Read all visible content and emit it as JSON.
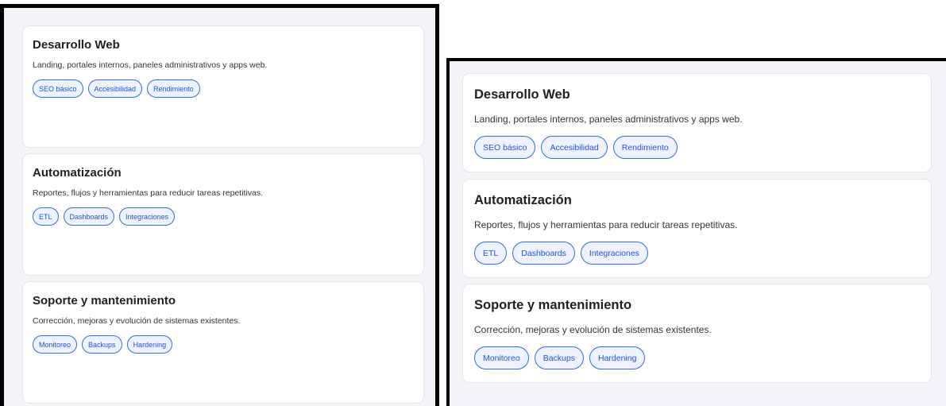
{
  "services": [
    {
      "title": "Desarrollo Web",
      "description": "Landing, portales internos, paneles administrativos y apps web.",
      "tags": [
        "SEO básico",
        "Accesibilidad",
        "Rendimiento"
      ]
    },
    {
      "title": "Automatización",
      "description": "Reportes, flujos y herramientas para reducir tareas repetitivas.",
      "tags": [
        "ETL",
        "Dashboards",
        "Integraciones"
      ]
    },
    {
      "title": "Soporte y mantenimiento",
      "description": "Corrección, mejoras y evolución de sistemas existentes.",
      "tags": [
        "Monitoreo",
        "Backups",
        "Hardening"
      ]
    }
  ],
  "colors": {
    "tag_border": "#2f6bf0",
    "tag_text": "#1c55e0",
    "tag_background": "#eef3ff",
    "panel_background": "#f4f4f8",
    "frame": "#000000"
  }
}
